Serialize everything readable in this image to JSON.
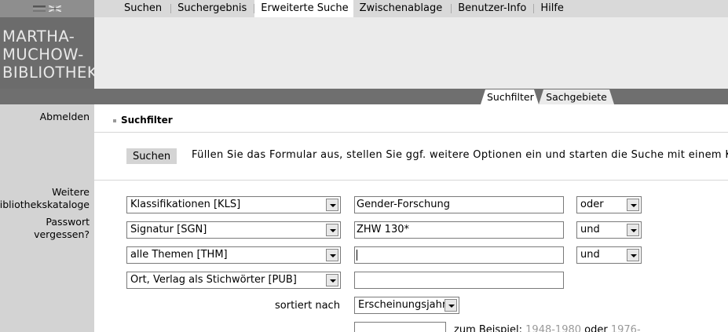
{
  "nav": {
    "flags": [
      "german-flag-icon",
      "uk-flag-icon"
    ],
    "items": [
      {
        "label": "Suchen",
        "active": false
      },
      {
        "label": "Suchergebnis",
        "active": false
      },
      {
        "label": "Erweiterte Suche",
        "active": true
      },
      {
        "label": "Zwischenablage",
        "active": false
      },
      {
        "label": "Benutzer-Info",
        "active": false
      },
      {
        "label": "Hilfe",
        "active": false
      }
    ]
  },
  "logo": {
    "lines": [
      "MARTHA-",
      "MUCHOW-",
      "BIBLIOTHEK"
    ]
  },
  "subtabs": [
    {
      "label": "Suchfilter",
      "active": true
    },
    {
      "label": "Sachgebiete",
      "active": false
    }
  ],
  "sidebar": {
    "logout": "Abmelden",
    "catalogs_line1": "Weitere",
    "catalogs_line2": "Bibliothekskataloge",
    "password_line1": "Passwort",
    "password_line2": "vergessen?"
  },
  "main": {
    "section_title": "Suchfilter",
    "search_button": "Suchen",
    "instructions": "Füllen Sie das Formular aus, stellen Sie ggf. weitere Optionen ein und starten die Suche mit einem Klick",
    "rows": [
      {
        "field": "Klassifikationen [KLS]",
        "value": "Gender-Forschung",
        "operator": "oder"
      },
      {
        "field": "Signatur [SGN]",
        "value": "ZHW 130*",
        "operator": "und"
      },
      {
        "field": "alle Themen [THM]",
        "value": "",
        "operator": "und"
      },
      {
        "field": "Ort, Verlag als Stichwörter [PUB]",
        "value": ""
      }
    ],
    "sort_label": "sortiert nach",
    "sort_value": "Erscheinungsjahr",
    "example_prefix": "zum Beispiel:",
    "example_1": "1948-1980",
    "example_or": "oder",
    "example_2": "1976-"
  },
  "colors": {
    "sidebar": "#d3d3d3",
    "darkbar": "#6f6f6f",
    "logo_bg": "#6c6c6c",
    "banner": "#ebebeb"
  }
}
